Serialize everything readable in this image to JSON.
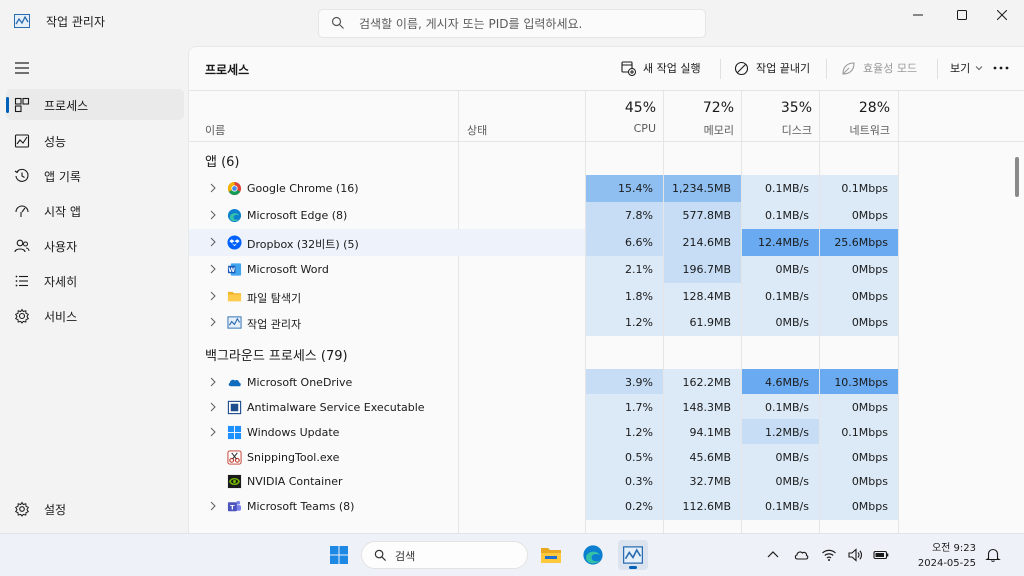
{
  "window": {
    "title": "작업 관리자"
  },
  "search": {
    "placeholder": "검색할 이름, 게시자 또는 PID를 입력하세요."
  },
  "sidebar": {
    "items": [
      {
        "label": "프로세스",
        "icon": "processes-icon",
        "active": true
      },
      {
        "label": "성능",
        "icon": "performance-icon"
      },
      {
        "label": "앱 기록",
        "icon": "app-history-icon"
      },
      {
        "label": "시작 앱",
        "icon": "startup-apps-icon"
      },
      {
        "label": "사용자",
        "icon": "users-icon"
      },
      {
        "label": "자세히",
        "icon": "details-icon"
      },
      {
        "label": "서비스",
        "icon": "services-icon"
      }
    ],
    "settings_label": "설정"
  },
  "toolbar": {
    "title": "프로세스",
    "new_task": "새 작업 실행",
    "end_task": "작업 끝내기",
    "efficiency_mode": "효율성 모드",
    "view": "보기"
  },
  "table": {
    "headers": {
      "name": "이름",
      "status": "상태",
      "cpu_pct": "45%",
      "cpu": "CPU",
      "mem_pct": "72%",
      "mem": "메모리",
      "disk_pct": "35%",
      "disk": "디스크",
      "net_pct": "28%",
      "net": "네트워크"
    },
    "groups": [
      {
        "title": "앱 (6)",
        "rows": [
          {
            "name": "Google Chrome (16)",
            "icon": "chrome-icon",
            "expandable": true,
            "cpu": "15.4%",
            "mem": "1,234.5MB",
            "disk": "0.1MB/s",
            "net": "0.1Mbps"
          },
          {
            "name": "Microsoft Edge (8)",
            "icon": "edge-icon",
            "expandable": true,
            "cpu": "7.8%",
            "mem": "577.8MB",
            "disk": "0.1MB/s",
            "net": "0Mbps"
          },
          {
            "name": "Dropbox (32비트) (5)",
            "icon": "dropbox-icon",
            "expandable": true,
            "selected": true,
            "cpu": "6.6%",
            "mem": "214.6MB",
            "disk": "12.4MB/s",
            "net": "25.6Mbps"
          },
          {
            "name": "Microsoft Word",
            "icon": "word-icon",
            "expandable": true,
            "cpu": "2.1%",
            "mem": "196.7MB",
            "disk": "0MB/s",
            "net": "0Mbps"
          },
          {
            "name": "파일 탐색기",
            "icon": "file-explorer-icon",
            "expandable": true,
            "cpu": "1.8%",
            "mem": "128.4MB",
            "disk": "0.1MB/s",
            "net": "0Mbps"
          },
          {
            "name": "작업 관리자",
            "icon": "task-manager-icon",
            "expandable": true,
            "cpu": "1.2%",
            "mem": "61.9MB",
            "disk": "0MB/s",
            "net": "0Mbps"
          }
        ]
      },
      {
        "title": "백그라운드 프로세스 (79)",
        "rows": [
          {
            "name": "Microsoft OneDrive",
            "icon": "onedrive-icon",
            "expandable": true,
            "cpu": "3.9%",
            "mem": "162.2MB",
            "disk": "4.6MB/s",
            "net": "10.3Mbps"
          },
          {
            "name": "Antimalware Service Executable",
            "icon": "antimalware-icon",
            "expandable": true,
            "cpu": "1.7%",
            "mem": "148.3MB",
            "disk": "0.1MB/s",
            "net": "0Mbps"
          },
          {
            "name": "Windows Update",
            "icon": "windows-update-icon",
            "expandable": true,
            "cpu": "1.2%",
            "mem": "94.1MB",
            "disk": "1.2MB/s",
            "net": "0.1Mbps"
          },
          {
            "name": "SnippingTool.exe",
            "icon": "snipping-tool-icon",
            "expandable": false,
            "cpu": "0.5%",
            "mem": "45.6MB",
            "disk": "0MB/s",
            "net": "0Mbps"
          },
          {
            "name": "NVIDIA Container",
            "icon": "nvidia-icon",
            "expandable": false,
            "cpu": "0.3%",
            "mem": "32.7MB",
            "disk": "0MB/s",
            "net": "0Mbps"
          },
          {
            "name": "Microsoft Teams (8)",
            "icon": "teams-icon",
            "expandable": true,
            "cpu": "0.2%",
            "mem": "112.6MB",
            "disk": "0.1MB/s",
            "net": "0Mbps"
          }
        ]
      }
    ]
  },
  "taskbar": {
    "search_label": "검색",
    "time": "오전 9:23",
    "date": "2024-05-25"
  }
}
